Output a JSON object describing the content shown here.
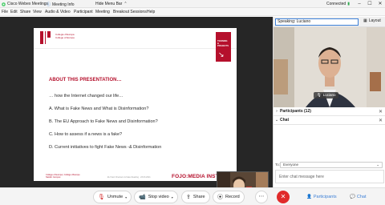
{
  "window": {
    "app_title": "Cisco Webex Meetings",
    "meeting_info": "Meeting Info",
    "hide_menu_bar": "Hide Menu Bar",
    "connection": "Connected",
    "minimize": "–",
    "maximize": "☐",
    "close": "✕"
  },
  "menu": [
    "File",
    "Edit",
    "Share",
    "View",
    "Audio & Video",
    "Participant",
    "Meeting",
    "Breakout Sessions",
    "Help"
  ],
  "slide": {
    "logo_line1": "Collegio d'Europa",
    "logo_line2": "College of Europe",
    "badge_line1": "TRAINING",
    "badge_line2": "& PROJECTS",
    "title": "ABOUT THIS PRESENTATION…",
    "intro": "… how the Internet changed our life…",
    "items": [
      "A.  What is Fake News and What is Disinformation?",
      "B.  The EU Approach to Fake News and Disinformation?",
      "C.  How to assess if a news is a fake?",
      "D.  Current initiatives to fight Fake News -& Disinformation"
    ],
    "footer_left_line1": "College of Europe | Collège d'Europe",
    "footer_left_line2": "Natolin Campus",
    "footer_mid": "EU Fact Checkers & Fake Reading · 23.03.2021",
    "footer_brand": "FOJO:MEDIA INST"
  },
  "speaking": {
    "label": "Speaking: Luciano",
    "layout_label": "Layout"
  },
  "speaker": {
    "name": "Luciano"
  },
  "panels": {
    "participants": "Participants (12)",
    "chat": "Chat",
    "close_icon": "✕"
  },
  "chat": {
    "to_label": "To:",
    "recipient": "Everyone",
    "placeholder": "Enter chat message here"
  },
  "controls": {
    "unmute": "Unmute",
    "stop_video": "Stop video",
    "share": "Share",
    "record": "Record",
    "more": "⋯",
    "end": "✕",
    "participants": "Participants",
    "chat": "Chat"
  },
  "colors": {
    "accent_red": "#b5102c",
    "end_red": "#e02a2a",
    "webex_blue": "#3c7fd6"
  }
}
